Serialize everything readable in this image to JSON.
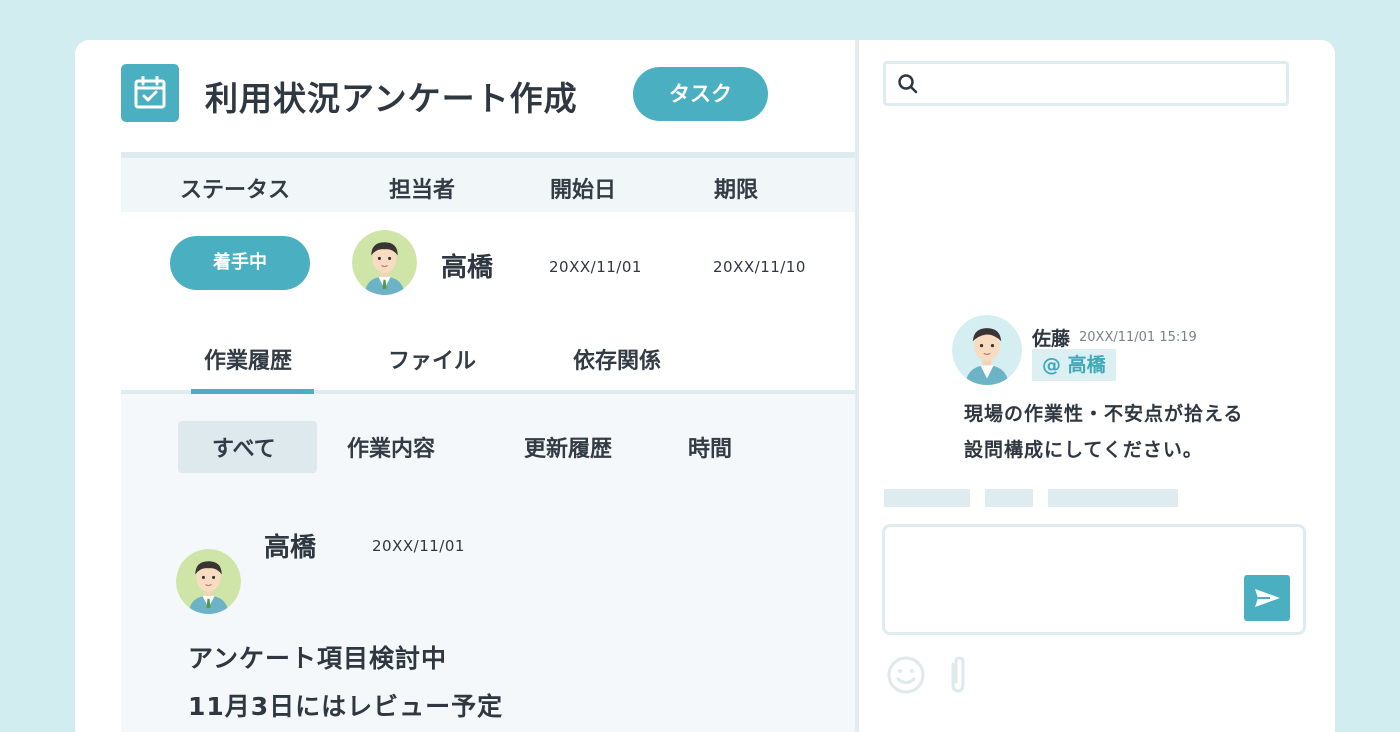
{
  "header": {
    "title": "利用状況アンケート作成",
    "task_button": "タスク"
  },
  "info": {
    "columns": [
      "ステータス",
      "担当者",
      "開始日",
      "期限"
    ],
    "status": "着手中",
    "assignee": "高橋",
    "start_date": "20XX/11/01",
    "due_date": "20XX/11/10"
  },
  "tabs": [
    "作業履歴",
    "ファイル",
    "依存関係"
  ],
  "filters": [
    "すべて",
    "作業内容",
    "更新履歴",
    "時間"
  ],
  "entry": {
    "author": "高橋",
    "date": "20XX/11/01",
    "lines": [
      "アンケート項目検討中",
      "11月3日にはレビュー予定"
    ]
  },
  "search": {
    "placeholder": ""
  },
  "comment": {
    "author": "佐藤",
    "time": "20XX/11/01 15:19",
    "mention": "@ 高橋",
    "lines": [
      "現場の作業性・不安点が拾える",
      "設問構成にしてください。"
    ]
  },
  "reply": {
    "placeholder": ""
  },
  "colors": {
    "background": "#d1edf0",
    "accent": "#4aafc0",
    "mention_bg": "#dcf0f3"
  },
  "icons": {
    "task": "calendar-check-icon",
    "search": "search-icon",
    "send": "send-icon",
    "emoji": "smile-icon",
    "attach": "paperclip-icon"
  }
}
